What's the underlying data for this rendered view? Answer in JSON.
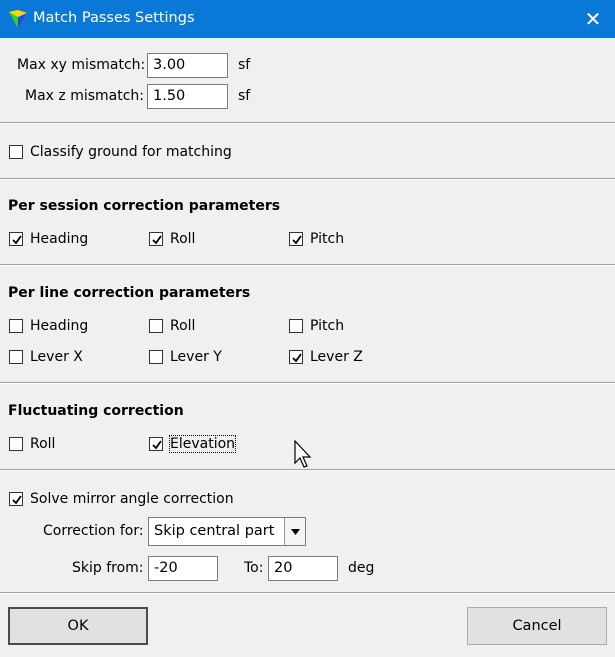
{
  "window": {
    "title": "Match Passes Settings",
    "close_glyph": "✕"
  },
  "mismatch": {
    "xy_label": "Max xy mismatch:",
    "xy_value": "3.00",
    "xy_unit": "sf",
    "z_label": "Max z mismatch:",
    "z_value": "1.50",
    "z_unit": "sf"
  },
  "classify": {
    "label": "Classify ground for matching",
    "checked": false
  },
  "per_session": {
    "title": "Per session correction parameters",
    "items": [
      {
        "label": "Heading",
        "checked": true
      },
      {
        "label": "Roll",
        "checked": true
      },
      {
        "label": "Pitch",
        "checked": true
      }
    ]
  },
  "per_line": {
    "title": "Per line correction parameters",
    "items": [
      {
        "label": "Heading",
        "checked": false
      },
      {
        "label": "Roll",
        "checked": false
      },
      {
        "label": "Pitch",
        "checked": false
      },
      {
        "label": "Lever X",
        "checked": false
      },
      {
        "label": "Lever Y",
        "checked": false
      },
      {
        "label": "Lever Z",
        "checked": true
      }
    ]
  },
  "fluctuating": {
    "title": "Fluctuating correction",
    "items": [
      {
        "label": "Roll",
        "checked": false
      },
      {
        "label": "Elevation",
        "checked": true
      }
    ]
  },
  "mirror": {
    "label": "Solve mirror angle correction",
    "checked": true,
    "correction_label": "Correction for:",
    "correction_value": "Skip central part",
    "skip_from_label": "Skip from:",
    "skip_from_value": "-20",
    "to_label": "To:",
    "to_value": "20",
    "unit": "deg"
  },
  "buttons": {
    "ok": "OK",
    "cancel": "Cancel"
  },
  "colors": {
    "titlebar": "#0a78d7",
    "dialog_bg": "#f0f0f0"
  }
}
